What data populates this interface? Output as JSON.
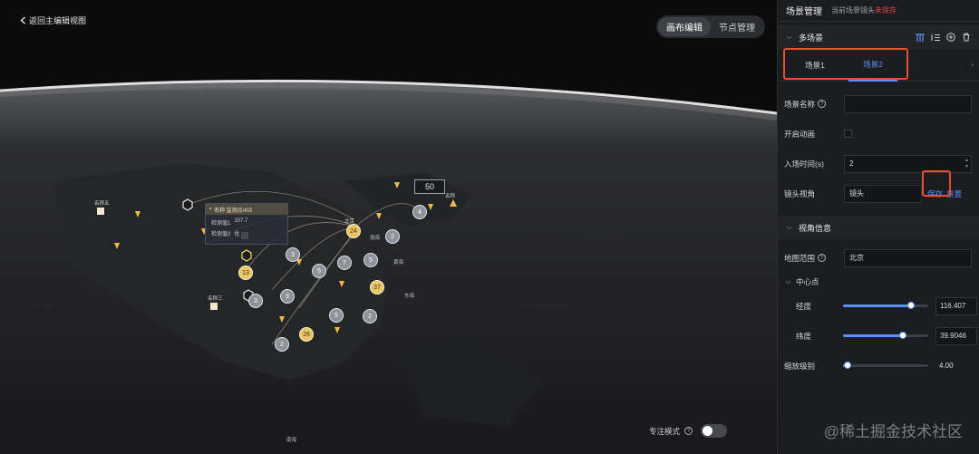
{
  "canvas": {
    "back_label": "返回主编辑视图",
    "mode_tabs": [
      "画布编辑",
      "节点管理"
    ],
    "focus_mode_label": "专注模式",
    "scale_value": "50",
    "popup": {
      "title": "名称 监测点#03",
      "row1_label": "检测值1",
      "row1_value": "107.7",
      "row2_label": "检测值2",
      "row2_value": "优"
    },
    "map_labels": {
      "bohai": "渤海",
      "huanghai": "黄海",
      "donghai": "东海",
      "nanhai": "南海",
      "beijing": "北京",
      "name5": "名称五",
      "name3": "名称三",
      "name_short": "名称"
    },
    "cluster_counts": [
      "4",
      "24",
      "2",
      "3",
      "5",
      "7",
      "5",
      "13",
      "3",
      "3",
      "37",
      "5",
      "2",
      "28",
      "2"
    ]
  },
  "panel": {
    "title": "场景管理",
    "subtitle_prefix": "当前场景镜头",
    "subtitle_warning": "未保存",
    "multi_scene_label": "多场景",
    "scene_tabs": [
      "场景1",
      "场景2"
    ],
    "form": {
      "scene_name_label": "场景名称",
      "scene_name_value": "",
      "animation_label": "开启动画",
      "enter_time_label": "入场时间(s)",
      "enter_time_value": "2",
      "camera_label": "镜头视角",
      "camera_value": "镜头",
      "save_label": "保存",
      "reset_label": "重置"
    },
    "view_info_label": "视角信息",
    "map_range_label": "地图范围",
    "map_range_value": "北京",
    "center_label": "中心点",
    "longitude_label": "经度",
    "longitude_value": "116.407",
    "longitude_fraction": 0.8,
    "latitude_label": "纬度",
    "latitude_value": "39.9046",
    "latitude_fraction": 0.7,
    "zoom_label": "缩放级别",
    "zoom_value": "4.00",
    "zoom_fraction": 0.05,
    "accent_color": "#5b8ff9",
    "warning_color": "#e5484d"
  },
  "watermark": "@稀土掘金技术社区"
}
